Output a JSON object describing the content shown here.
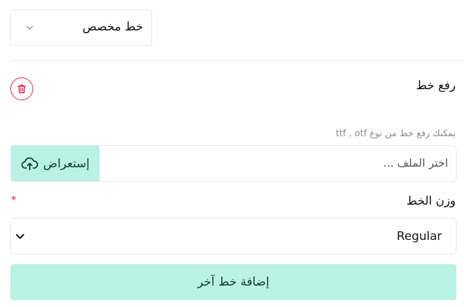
{
  "font_type": {
    "selected": "خط مخصص",
    "icon": "chevron-down-icon"
  },
  "upload": {
    "title": "رفع خط",
    "delete_icon": "trash-icon",
    "hint": "يمكنك رفع خط من نوع ttf , otf",
    "placeholder": "اختر الملف ...",
    "browse_label": "إستعراض",
    "browse_icon": "cloud-upload-icon"
  },
  "weight": {
    "label": "وزن الخط",
    "required_mark": "*",
    "selected": "Regular",
    "icon": "chevron-down-icon"
  },
  "add_font": {
    "label": "إضافة خط آخر"
  },
  "colors": {
    "accent": "#b9f2e2",
    "accent_text": "#0f3b3a",
    "danger": "#e11d48"
  }
}
